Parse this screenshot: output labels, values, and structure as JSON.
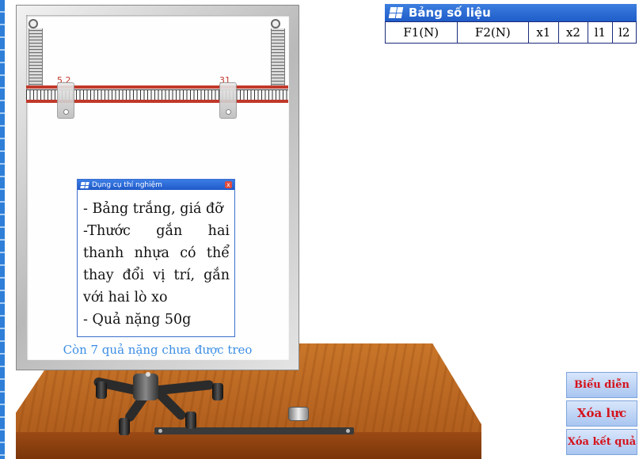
{
  "table": {
    "title": "Bảng số liệu",
    "columns": [
      "F1(N)",
      "F2(N)",
      "x1",
      "x2",
      "l1",
      "l2"
    ]
  },
  "ruler": {
    "left_mark": "5.2",
    "right_mark": "31"
  },
  "dialog": {
    "title": "Dụng cụ thí nghiệm",
    "close": "x",
    "lines": [
      "- Bảng trắng, giá đỡ",
      "-Thước gắn hai thanh nhựa có thể thay đổi vị trí, gắn với hai lò xo",
      "- Quả nặng 50g"
    ]
  },
  "board": {
    "caption": "Còn 7 quả nặng chưa được treo"
  },
  "buttons": {
    "show_force": "Biểu diễn lực",
    "clear_force": "Xóa lực",
    "clear_results": "Xóa kết quả"
  }
}
